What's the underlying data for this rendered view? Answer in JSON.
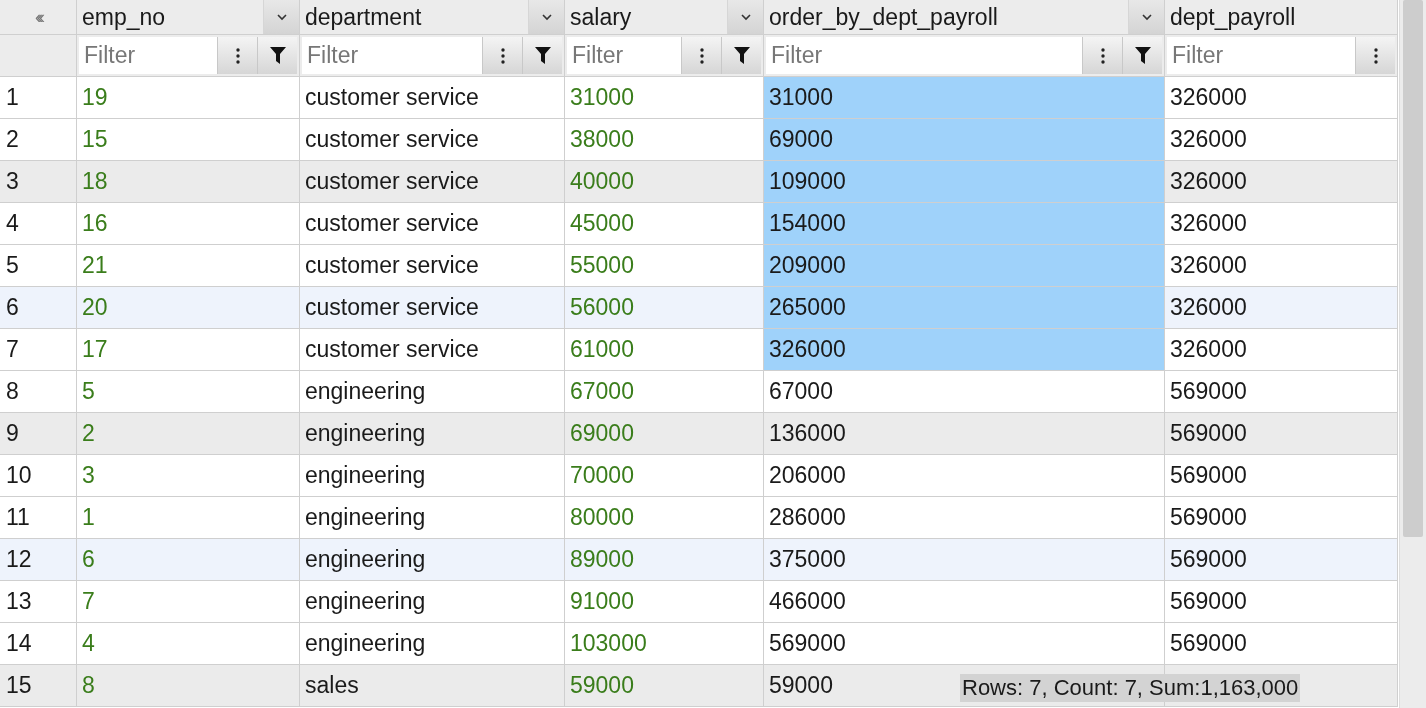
{
  "collapse_button": {
    "label": "‹‹‹"
  },
  "columns": [
    {
      "name": "emp_no",
      "emphasized": true,
      "sort_menu": true,
      "filter": {
        "placeholder": "Filter",
        "funnel": true
      }
    },
    {
      "name": "department",
      "emphasized": false,
      "sort_menu": true,
      "filter": {
        "placeholder": "Filter",
        "funnel": true
      }
    },
    {
      "name": "salary",
      "emphasized": true,
      "sort_menu": true,
      "filter": {
        "placeholder": "Filter",
        "funnel": true
      }
    },
    {
      "name": "order_by_dept_payroll",
      "emphasized": false,
      "sort_menu": true,
      "filter": {
        "placeholder": "Filter",
        "funnel": true
      }
    },
    {
      "name": "dept_payroll",
      "emphasized": false,
      "sort_menu": false,
      "filter": {
        "placeholder": "Filter",
        "funnel": false
      }
    }
  ],
  "rows": [
    {
      "number": "1",
      "striped": false,
      "highlighted": false,
      "cells": [
        {
          "text": "19",
          "selected": false
        },
        {
          "text": "customer service",
          "selected": false
        },
        {
          "text": "31000",
          "selected": false
        },
        {
          "text": "31000",
          "selected": true
        },
        {
          "text": "326000",
          "selected": false
        }
      ]
    },
    {
      "number": "2",
      "striped": false,
      "highlighted": false,
      "cells": [
        {
          "text": "15",
          "selected": false
        },
        {
          "text": "customer service",
          "selected": false
        },
        {
          "text": "38000",
          "selected": false
        },
        {
          "text": "69000",
          "selected": true
        },
        {
          "text": "326000",
          "selected": false
        }
      ]
    },
    {
      "number": "3",
      "striped": true,
      "highlighted": false,
      "cells": [
        {
          "text": "18",
          "selected": false
        },
        {
          "text": "customer service",
          "selected": false
        },
        {
          "text": "40000",
          "selected": false
        },
        {
          "text": "109000",
          "selected": true
        },
        {
          "text": "326000",
          "selected": false
        }
      ]
    },
    {
      "number": "4",
      "striped": false,
      "highlighted": false,
      "cells": [
        {
          "text": "16",
          "selected": false
        },
        {
          "text": "customer service",
          "selected": false
        },
        {
          "text": "45000",
          "selected": false
        },
        {
          "text": "154000",
          "selected": true
        },
        {
          "text": "326000",
          "selected": false
        }
      ]
    },
    {
      "number": "5",
      "striped": false,
      "highlighted": false,
      "cells": [
        {
          "text": "21",
          "selected": false
        },
        {
          "text": "customer service",
          "selected": false
        },
        {
          "text": "55000",
          "selected": false
        },
        {
          "text": "209000",
          "selected": true
        },
        {
          "text": "326000",
          "selected": false
        }
      ]
    },
    {
      "number": "6",
      "striped": false,
      "highlighted": true,
      "cells": [
        {
          "text": "20",
          "selected": false
        },
        {
          "text": "customer service",
          "selected": false
        },
        {
          "text": "56000",
          "selected": false
        },
        {
          "text": "265000",
          "selected": true
        },
        {
          "text": "326000",
          "selected": false
        }
      ]
    },
    {
      "number": "7",
      "striped": false,
      "highlighted": false,
      "cells": [
        {
          "text": "17",
          "selected": false
        },
        {
          "text": "customer service",
          "selected": false
        },
        {
          "text": "61000",
          "selected": false
        },
        {
          "text": "326000",
          "selected": true
        },
        {
          "text": "326000",
          "selected": false
        }
      ]
    },
    {
      "number": "8",
      "striped": false,
      "highlighted": false,
      "cells": [
        {
          "text": "5",
          "selected": false
        },
        {
          "text": "engineering",
          "selected": false
        },
        {
          "text": "67000",
          "selected": false
        },
        {
          "text": "67000",
          "selected": false
        },
        {
          "text": "569000",
          "selected": false
        }
      ]
    },
    {
      "number": "9",
      "striped": true,
      "highlighted": false,
      "cells": [
        {
          "text": "2",
          "selected": false
        },
        {
          "text": "engineering",
          "selected": false
        },
        {
          "text": "69000",
          "selected": false
        },
        {
          "text": "136000",
          "selected": false
        },
        {
          "text": "569000",
          "selected": false
        }
      ]
    },
    {
      "number": "10",
      "striped": false,
      "highlighted": false,
      "cells": [
        {
          "text": "3",
          "selected": false
        },
        {
          "text": "engineering",
          "selected": false
        },
        {
          "text": "70000",
          "selected": false
        },
        {
          "text": "206000",
          "selected": false
        },
        {
          "text": "569000",
          "selected": false
        }
      ]
    },
    {
      "number": "11",
      "striped": false,
      "highlighted": false,
      "cells": [
        {
          "text": "1",
          "selected": false
        },
        {
          "text": "engineering",
          "selected": false
        },
        {
          "text": "80000",
          "selected": false
        },
        {
          "text": "286000",
          "selected": false
        },
        {
          "text": "569000",
          "selected": false
        }
      ]
    },
    {
      "number": "12",
      "striped": false,
      "highlighted": true,
      "cells": [
        {
          "text": "6",
          "selected": false
        },
        {
          "text": "engineering",
          "selected": false
        },
        {
          "text": "89000",
          "selected": false
        },
        {
          "text": "375000",
          "selected": false
        },
        {
          "text": "569000",
          "selected": false
        }
      ]
    },
    {
      "number": "13",
      "striped": false,
      "highlighted": false,
      "cells": [
        {
          "text": "7",
          "selected": false
        },
        {
          "text": "engineering",
          "selected": false
        },
        {
          "text": "91000",
          "selected": false
        },
        {
          "text": "466000",
          "selected": false
        },
        {
          "text": "569000",
          "selected": false
        }
      ]
    },
    {
      "number": "14",
      "striped": false,
      "highlighted": false,
      "cells": [
        {
          "text": "4",
          "selected": false
        },
        {
          "text": "engineering",
          "selected": false
        },
        {
          "text": "103000",
          "selected": false
        },
        {
          "text": "569000",
          "selected": false
        },
        {
          "text": "569000",
          "selected": false
        }
      ]
    },
    {
      "number": "15",
      "striped": true,
      "highlighted": false,
      "cells": [
        {
          "text": "8",
          "selected": false
        },
        {
          "text": "sales",
          "selected": false
        },
        {
          "text": "59000",
          "selected": false
        },
        {
          "text": "59000",
          "selected": false
        }
      ]
    }
  ],
  "status_summary": "Rows: 7, Count: 7, Sum:1,163,000"
}
